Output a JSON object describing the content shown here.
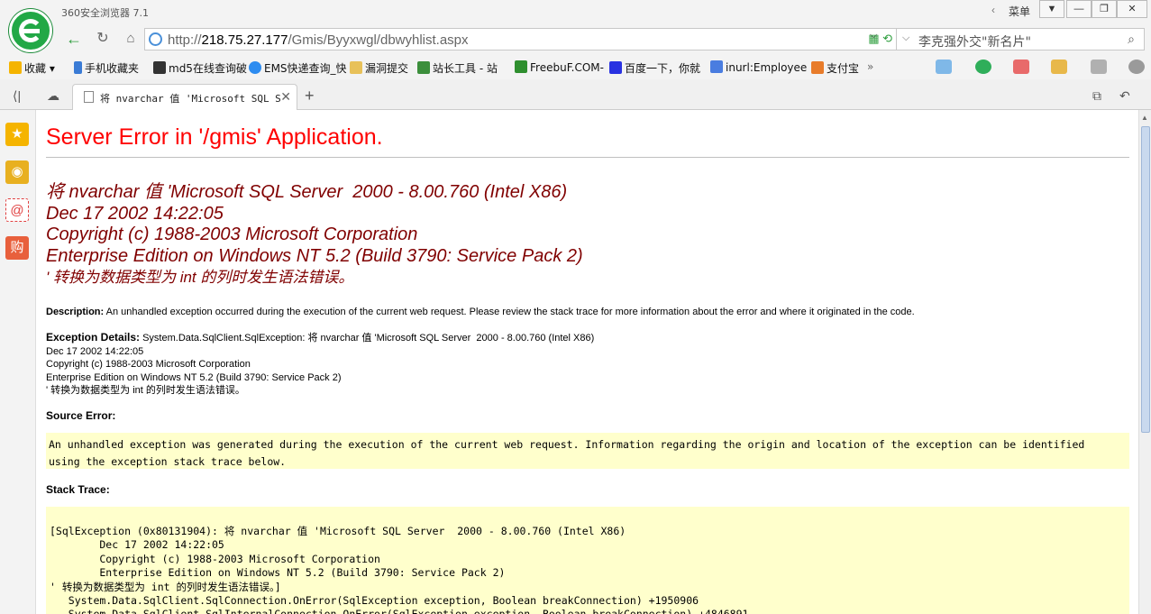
{
  "app": {
    "title": "360安全浏览器 7.1",
    "menu_label": "菜单",
    "window_controls": [
      "shirt-icon",
      "minimize-icon",
      "maximize-icon",
      "close-icon"
    ]
  },
  "toolbar": {
    "url_prefix": "http://",
    "url_host": "218.75.27.177",
    "url_path": "/Gmis/Byyxwgl/dbwyhlist.aspx",
    "search_text": "李克强外交\"新名片\""
  },
  "bookmarks": [
    {
      "label": "收藏",
      "icon": "star-icon",
      "color": "#f5b400"
    },
    {
      "label": "手机收藏夹",
      "icon": "phone-icon",
      "color": "#3a7bd5"
    },
    {
      "label": "md5在线查询破",
      "icon": "grid-icon",
      "color": "#333333"
    },
    {
      "label": "EMS快递查询_快",
      "icon": "globe-icon",
      "color": "#2d8cf0"
    },
    {
      "label": "漏洞提交",
      "icon": "folder-icon",
      "color": "#e8c15a"
    },
    {
      "label": "站长工具 - 站",
      "icon": "chart-icon",
      "color": "#3c8f3c"
    },
    {
      "label": "FreebuF.COM-",
      "icon": "freebuf-icon",
      "color": "#2f8f2f"
    },
    {
      "label": "百度一下，你就",
      "icon": "paw-icon",
      "color": "#2932e1"
    },
    {
      "label": "inurl:Employee",
      "icon": "google-icon",
      "color": "#4a7de0"
    },
    {
      "label": "支付宝",
      "icon": "shield-icon",
      "color": "#e87c2b"
    }
  ],
  "tab": {
    "title": "将 nvarchar 值 'Microsoft SQL Server",
    "new_tab_label": "+"
  },
  "page": {
    "title": "Server Error in '/gmis' Application.",
    "error_lines": [
      "将 nvarchar 值 'Microsoft SQL Server  2000 - 8.00.760 (Intel X86)",
      "Dec 17 2002 14:22:05",
      "Copyright (c) 1988-2003 Microsoft Corporation",
      "Enterprise Edition on Windows NT 5.2 (Build 3790: Service Pack 2)",
      "' 转换为数据类型为 int 的列时发生语法错误。"
    ],
    "description_label": "Description:",
    "description_text": " An unhandled exception occurred during the execution of the current web request. Please review the stack trace for more information about the error and where it originated in the code.",
    "exception_label": "Exception Details:",
    "exception_first": " System.Data.SqlClient.SqlException: 将 nvarchar 值 'Microsoft SQL Server  2000 - 8.00.760 (Intel X86)",
    "exception_rest": "Dec 17 2002 14:22:05\nCopyright (c) 1988-2003 Microsoft Corporation\nEnterprise Edition on Windows NT 5.2 (Build 3790: Service Pack 2)\n' 转换为数据类型为 int 的列时发生语法错误。",
    "source_error_label": "Source Error:",
    "source_error_text": "An unhandled exception was generated during the execution of the current web request. Information regarding the origin and location of the exception can be identified\nusing the exception stack trace below.",
    "stack_trace_label": "Stack Trace:",
    "stack_trace_text": "[SqlException (0x80131904): 将 nvarchar 值 'Microsoft SQL Server  2000 - 8.00.760 (Intel X86)\n        Dec 17 2002 14:22:05\n        Copyright (c) 1988-2003 Microsoft Corporation\n        Enterprise Edition on Windows NT 5.2 (Build 3790: Service Pack 2)\n' 转换为数据类型为 int 的列时发生语法错误。]\n   System.Data.SqlClient.SqlConnection.OnError(SqlException exception, Boolean breakConnection) +1950906\n   System.Data.SqlClient.SqlInternalConnection.OnError(SqlException exception, Boolean breakConnection) +4846891"
  },
  "colors": {
    "title_red": "#ff0000",
    "error_maroon": "#800000",
    "code_bg": "#ffffcc",
    "brand_green": "#22a846"
  }
}
